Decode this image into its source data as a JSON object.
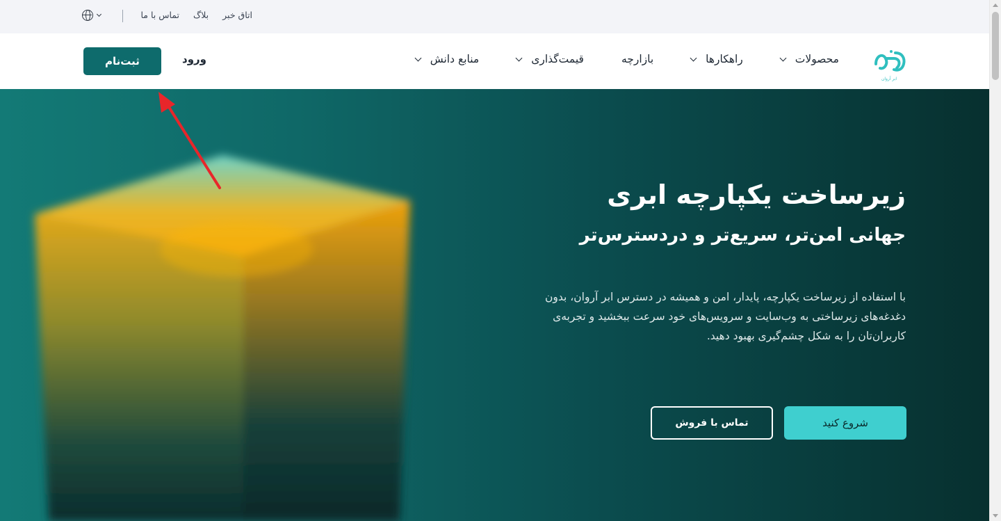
{
  "topbar": {
    "links": [
      "اتاق خبر",
      "بلاگ",
      "تماس با ما"
    ],
    "language_icon": "globe-icon"
  },
  "nav": {
    "logo_caption": "ابر آروان",
    "items": [
      {
        "label": "محصولات",
        "has_dropdown": true
      },
      {
        "label": "راهکارها",
        "has_dropdown": true
      },
      {
        "label": "بازارچه",
        "has_dropdown": false
      },
      {
        "label": "قیمت‌گذاری",
        "has_dropdown": true
      },
      {
        "label": "منابع دانش",
        "has_dropdown": true
      }
    ],
    "login_label": "ورود",
    "signup_label": "ثبت‌نام"
  },
  "hero": {
    "title": "زیرساخت یکپارچه ابری",
    "subtitle": "جهانی امن‌تر، سریع‌تر و دردسترس‌تر",
    "description": "با استفاده از زیرساخت یکپارچه، پایدار، امن و همیشه در دسترس ابر آروان، بدون دغدغه‌های زیرساختی به وب‌سایت و سرویس‌های خود سرعت ببخشید و تجربه‌ی کاربران‌تان را به شکل چشم‌گیری بهبود دهید.",
    "primary_cta": "شروع کنید",
    "secondary_cta": "تماس با فروش"
  },
  "colors": {
    "brand": "#0e6b6c",
    "accent": "#3fcfcf",
    "topbar_bg": "#f3f4f8",
    "annotation_arrow": "#e8262a"
  }
}
